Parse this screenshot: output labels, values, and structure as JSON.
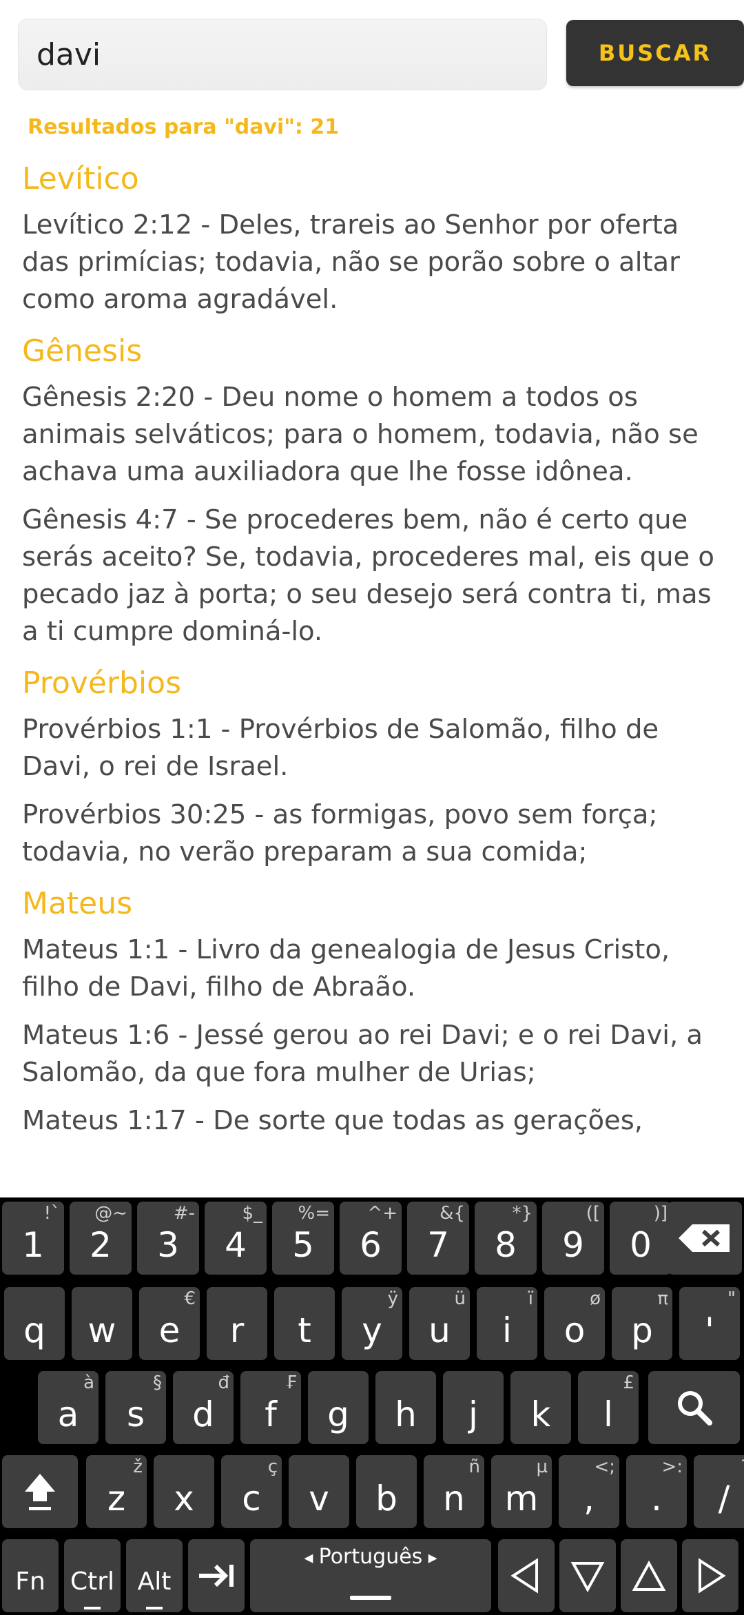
{
  "search": {
    "value": "davi",
    "button_label": "BUSCAR"
  },
  "results_label": "Resultados para \"davi\": 21",
  "groups": [
    {
      "book": "Levítico",
      "verses": [
        "Levítico 2:12 - Deles, trareis ao Senhor por oferta das primícias; todavia, não se porão sobre o altar como aroma agradável."
      ]
    },
    {
      "book": "Gênesis",
      "verses": [
        "Gênesis 2:20 - Deu nome o homem a todos os animais selváticos; para o homem, todavia, não se achava uma auxiliadora que lhe fosse idônea.",
        "Gênesis 4:7 - Se procederes bem, não é certo que serás aceito? Se, todavia, procederes mal, eis que o pecado jaz à porta; o seu desejo será contra ti, mas a ti cumpre dominá-lo."
      ]
    },
    {
      "book": "Provérbios",
      "verses": [
        "Provérbios 1:1 - Provérbios de Salomão, filho de Davi, o rei de Israel.",
        "Provérbios 30:25 - as formigas, povo sem força; todavia, no verão preparam a sua comida;"
      ]
    },
    {
      "book": "Mateus",
      "verses": [
        "Mateus 1:1 - Livro da genealogia de Jesus Cristo, filho de Davi, filho de Abraão.",
        "Mateus 1:6 - Jessé gerou ao rei Davi; e o rei Davi, a Salomão, da que fora mulher de Urias;",
        "Mateus 1:17 - De sorte que todas as gerações,"
      ]
    }
  ],
  "keyboard": {
    "row1": [
      [
        "1",
        "!`"
      ],
      [
        "2",
        "@~"
      ],
      [
        "3",
        "#-"
      ],
      [
        "4",
        "$_"
      ],
      [
        "5",
        "%="
      ],
      [
        "6",
        "^+"
      ],
      [
        "7",
        "&{"
      ],
      [
        "8",
        "*}"
      ],
      [
        "9",
        "(["
      ],
      [
        "0",
        ")]"
      ]
    ],
    "row2": [
      [
        "q",
        ""
      ],
      [
        "w",
        ""
      ],
      [
        "e",
        "€"
      ],
      [
        "r",
        ""
      ],
      [
        "t",
        ""
      ],
      [
        "y",
        "ÿ"
      ],
      [
        "u",
        "ü"
      ],
      [
        "i",
        "ï"
      ],
      [
        "o",
        "ø"
      ],
      [
        "p",
        "π"
      ],
      [
        "'",
        "\""
      ]
    ],
    "row3": [
      [
        "a",
        "à"
      ],
      [
        "s",
        "§"
      ],
      [
        "d",
        "đ"
      ],
      [
        "f",
        "₣"
      ],
      [
        "g",
        ""
      ],
      [
        "h",
        ""
      ],
      [
        "j",
        ""
      ],
      [
        "k",
        ""
      ],
      [
        "l",
        "£"
      ]
    ],
    "row4": [
      [
        "z",
        "ž"
      ],
      [
        "x",
        ""
      ],
      [
        "c",
        "ç"
      ],
      [
        "v",
        ""
      ],
      [
        "b",
        ""
      ],
      [
        "n",
        "ñ"
      ],
      [
        "m",
        "µ"
      ],
      [
        ",",
        "<;"
      ],
      [
        ".",
        ">:"
      ],
      [
        "/",
        "?"
      ]
    ],
    "fn": "Fn",
    "ctrl": "Ctrl",
    "alt": "Alt",
    "language": "Português"
  }
}
